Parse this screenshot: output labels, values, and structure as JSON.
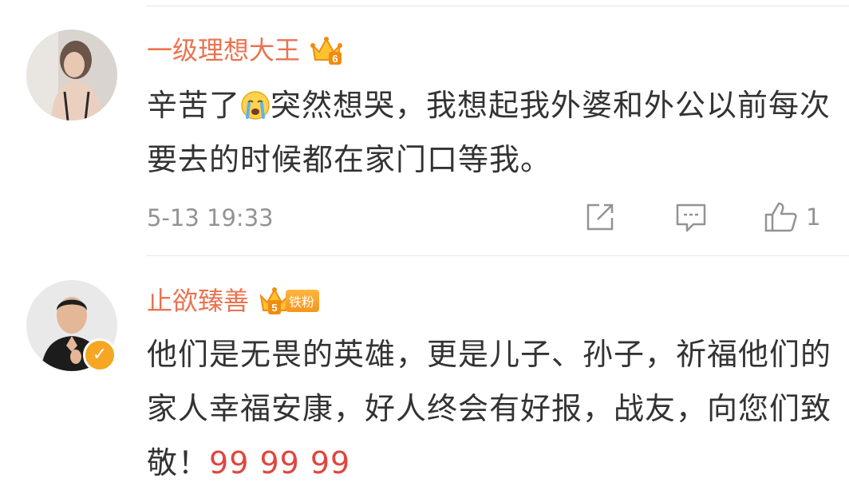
{
  "comments": [
    {
      "username": "一级理想大王",
      "level": "6",
      "text_before_emoji": "辛苦了",
      "emoji": "crying-emoji",
      "text_after_emoji": "突然想哭，我想起我外婆和外公以前每次要去的时候都在家门口等我。",
      "time": "5-13 19:33",
      "like_count": "1"
    },
    {
      "username": "止欲臻善",
      "level": "5",
      "fan_badge": "铁粉",
      "text": "他们是无畏的英雄，更是儿子、孙子，祈福他们的家人幸福安康，好人终会有好报，战",
      "text_partial": "友，向您们致敬！",
      "text_partial_highlight": "99 99 99"
    }
  ],
  "colors": {
    "username": "#eb7350",
    "text": "#333333",
    "meta": "#939393",
    "badge": "#f7941d",
    "verified": "#f5a623"
  }
}
